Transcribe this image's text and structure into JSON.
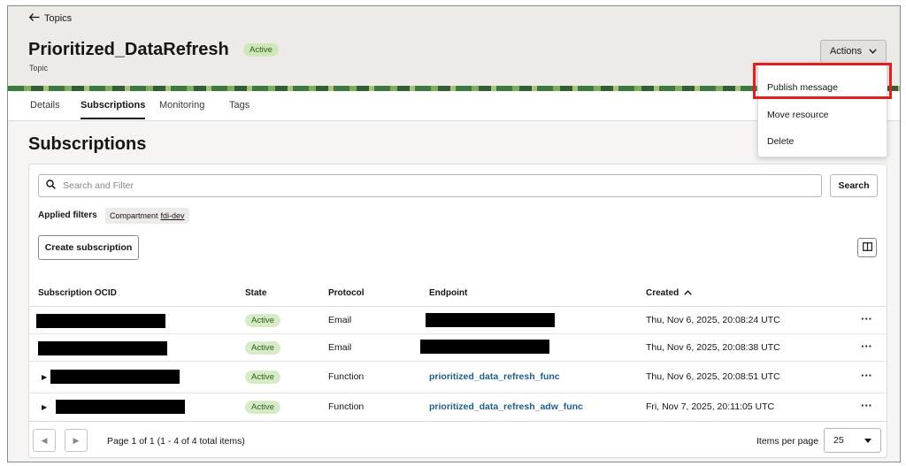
{
  "header": {
    "back_label": "Topics",
    "title": "Prioritized_DataRefresh",
    "status_badge": "Active",
    "subtitle": "Topic",
    "actions_label": "Actions"
  },
  "tabs": [
    {
      "label": "Details",
      "active": false
    },
    {
      "label": "Subscriptions",
      "active": true
    },
    {
      "label": "Monitoring",
      "active": false
    },
    {
      "label": "Tags",
      "active": false
    }
  ],
  "section_title": "Subscriptions",
  "search": {
    "placeholder": "Search and Filter",
    "button_label": "Search"
  },
  "filters": {
    "label": "Applied filters",
    "chip_name": "Compartment",
    "chip_value": "fdi-dev"
  },
  "create_button_label": "Create subscription",
  "table": {
    "columns": [
      "Subscription OCID",
      "State",
      "Protocol",
      "Endpoint",
      "Created"
    ],
    "sort_indicator": "ascending",
    "rows": [
      {
        "state": "Active",
        "protocol": "Email",
        "endpoint": "",
        "created": "Thu, Nov 6, 2025, 20:08:24 UTC",
        "expandable": false,
        "redacted": true
      },
      {
        "state": "Active",
        "protocol": "Email",
        "endpoint": "",
        "created": "Thu, Nov 6, 2025, 20:08:38 UTC",
        "expandable": false,
        "redacted": true
      },
      {
        "state": "Active",
        "protocol": "Function",
        "endpoint": "prioritized_data_refresh_func",
        "created": "Thu, Nov 6, 2025, 20:08:51 UTC",
        "expandable": true,
        "redacted": true
      },
      {
        "state": "Active",
        "protocol": "Function",
        "endpoint": "prioritized_data_refresh_adw_func",
        "created": "Fri, Nov 7, 2025, 20:11:05 UTC",
        "expandable": true,
        "redacted": true
      }
    ]
  },
  "pagination": {
    "page_info": "Page 1 of 1 (1 - 4 of 4 total items)",
    "items_per_page_label": "Items per page",
    "page_size": "25"
  },
  "actions_menu": {
    "items": [
      "Publish message",
      "Move resource",
      "Delete"
    ],
    "highlighted": "Publish message"
  },
  "colors": {
    "active_badge_bg": "#d7ecc6",
    "link": "#1e5f8a",
    "highlight": "#e02020"
  }
}
